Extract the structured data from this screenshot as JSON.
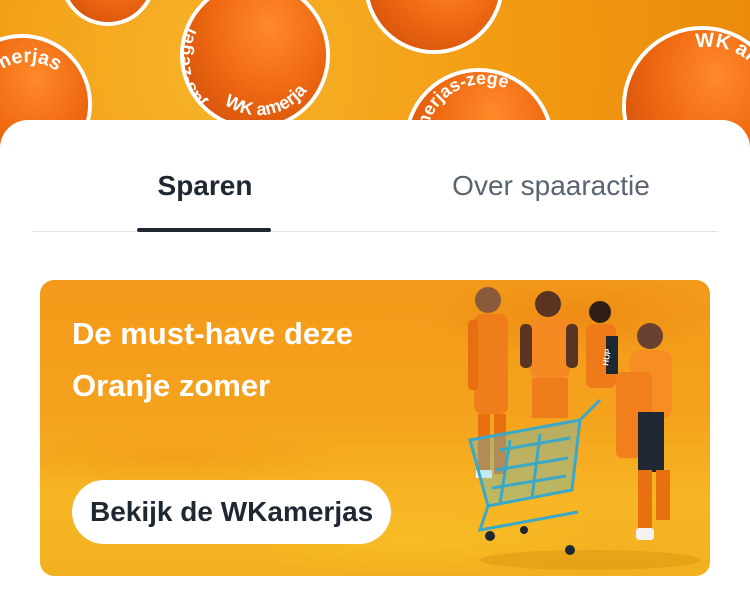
{
  "header": {
    "stamp_text": "WKamerjas-zegel",
    "stamp_fragments": [
      "WK amerjas",
      "jas-zegel",
      "WK amerjas-",
      "amerjas-zege",
      "WK amerjas"
    ]
  },
  "tabs": [
    {
      "label": "Sparen",
      "active": true
    },
    {
      "label": "Over spaaractie",
      "active": false
    }
  ],
  "banner": {
    "title_line1": "De must-have deze",
    "title_line2": "Oranje zomer",
    "cta_label": "Bekijk de WKamerjas",
    "jersey_badge": "HUP"
  },
  "colors": {
    "brand_orange": "#f29a12",
    "jersey_orange": "#ee6a10",
    "text_dark": "#1f2733",
    "text_muted": "#5a6470"
  }
}
